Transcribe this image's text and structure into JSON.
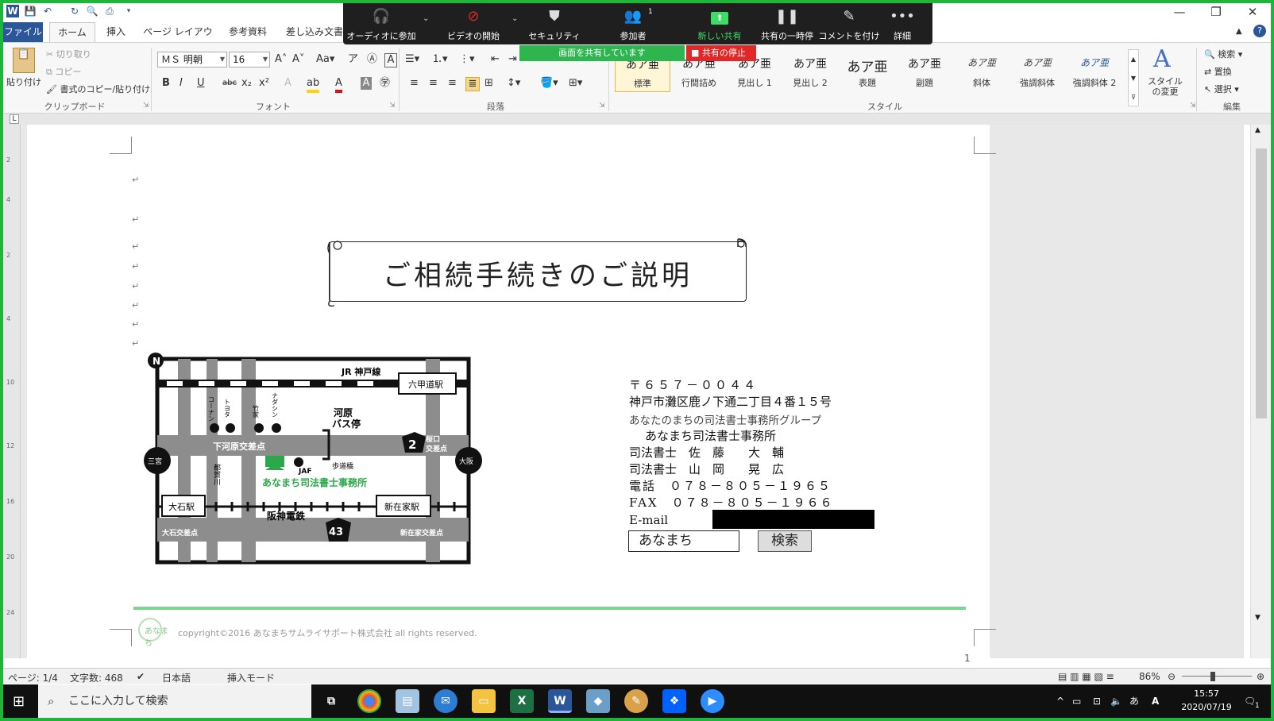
{
  "qat": {
    "app_icon": "W",
    "undo_icon": "undo-icon",
    "print_icon": "print-icon"
  },
  "window": {
    "minimize": "—",
    "restore": "❐",
    "close": "✕"
  },
  "tabs": [
    "ファイル",
    "ホーム",
    "挿入",
    "ページ レイアウト",
    "参考資料",
    "差し込み文書"
  ],
  "ribbon": {
    "paste": "貼り付け",
    "cut": "切り取り",
    "copy": "コピー",
    "format_painter": "書式のコピー/貼り付け",
    "clipboard_label": "クリップボード",
    "font_name": "ＭＳ 明朝",
    "font_size": "16",
    "font_label": "フォント",
    "paragraph_label": "段落",
    "styles_label": "スタイル",
    "styles": [
      {
        "sample": "あア亜",
        "name": "標準"
      },
      {
        "sample": "あア亜",
        "name": "行間詰め"
      },
      {
        "sample": "あア亜",
        "name": "見出し 1"
      },
      {
        "sample": "あア亜",
        "name": "見出し 2"
      },
      {
        "sample": "あア亜",
        "name": "表題"
      },
      {
        "sample": "あア亜",
        "name": "副題"
      },
      {
        "sample": "あア亜",
        "name": "斜体"
      },
      {
        "sample": "あア亜",
        "name": "強調斜体"
      },
      {
        "sample": "あア亜",
        "name": "強調斜体 2"
      }
    ],
    "change_styles": "スタイルの変更",
    "find": "検索",
    "replace": "置換",
    "select": "選択",
    "editing_label": "編集"
  },
  "zoom": {
    "items": [
      {
        "label": "オーディオに参加",
        "icon": "headphones-icon"
      },
      {
        "label": "ビデオの開始",
        "icon": "video-off-icon"
      },
      {
        "label": "セキュリティ",
        "icon": "shield-icon"
      },
      {
        "label": "参加者",
        "icon": "participants-icon",
        "badge": "1"
      },
      {
        "label": "新しい共有",
        "icon": "share-screen-icon"
      },
      {
        "label": "共有の一時停",
        "icon": "pause-icon"
      },
      {
        "label": "コメントを付け",
        "icon": "pen-icon"
      },
      {
        "label": "詳細",
        "icon": "more-icon"
      }
    ],
    "sharing_status": "画面を共有しています",
    "stop_share": "共有の停止",
    "accent": "#3ddc67",
    "stop_color": "#e02828"
  },
  "document": {
    "title": "ご相続手続きのご説明",
    "paragraph_mark": "↵",
    "address": {
      "postal": "〒６５７－００４４",
      "street": "神戸市灘区鹿ノ下通二丁目４番１５号",
      "group": "あなたのまちの司法書士事務所グループ",
      "office": "あなまち司法書士事務所",
      "person1": "司法書士　佐　藤　　大　輔",
      "person2": "司法書士　山　岡　　晃　広",
      "tel": "電話　０７８－８０５－１９６５",
      "fax": "FAX　０７８－８０５－１９６６",
      "email_label": "E-mail"
    },
    "search_box": "あなまち",
    "search_button": "検索",
    "copyright": "copyright©2016 あなまちサムライサポート株式会社 all rights reserved.",
    "footer_logo": "あなまち",
    "page_number": "1"
  },
  "map": {
    "north": "N",
    "jr_line": "JR 神戸線",
    "rokko_station": "六甲道駅",
    "stores": [
      "コーナン",
      "トヨタ",
      "竹家",
      "ナダシン"
    ],
    "bus_stop": "河原\nバス停",
    "intersection_shimo": "下河原交差点",
    "route2": "2",
    "sakuraguchi": "桜口\n交差点",
    "sannomiya": "三宮",
    "osaka": "大阪",
    "tsugagawa": "都賀川",
    "jaf": "JAF",
    "footbridge": "歩道橋",
    "office": "あなまち司法書士事務所",
    "ishiya_station": "大石駅",
    "shinzaike_station": "新在家駅",
    "hanshin": "阪神電鉄",
    "route43": "43",
    "ishiya_intersection": "大石交差点",
    "shinzaike_intersection": "新在家交差点",
    "office_color": "#2aa84a"
  },
  "status": {
    "page": "ページ: 1/4",
    "words": "文字数: 468",
    "language": "日本語",
    "mode": "挿入モード",
    "zoom": "86%"
  },
  "taskbar": {
    "search_placeholder": "ここに入力して検索",
    "ime": "あ",
    "time": "15:57",
    "date": "2020/07/19",
    "notifications": "1"
  }
}
